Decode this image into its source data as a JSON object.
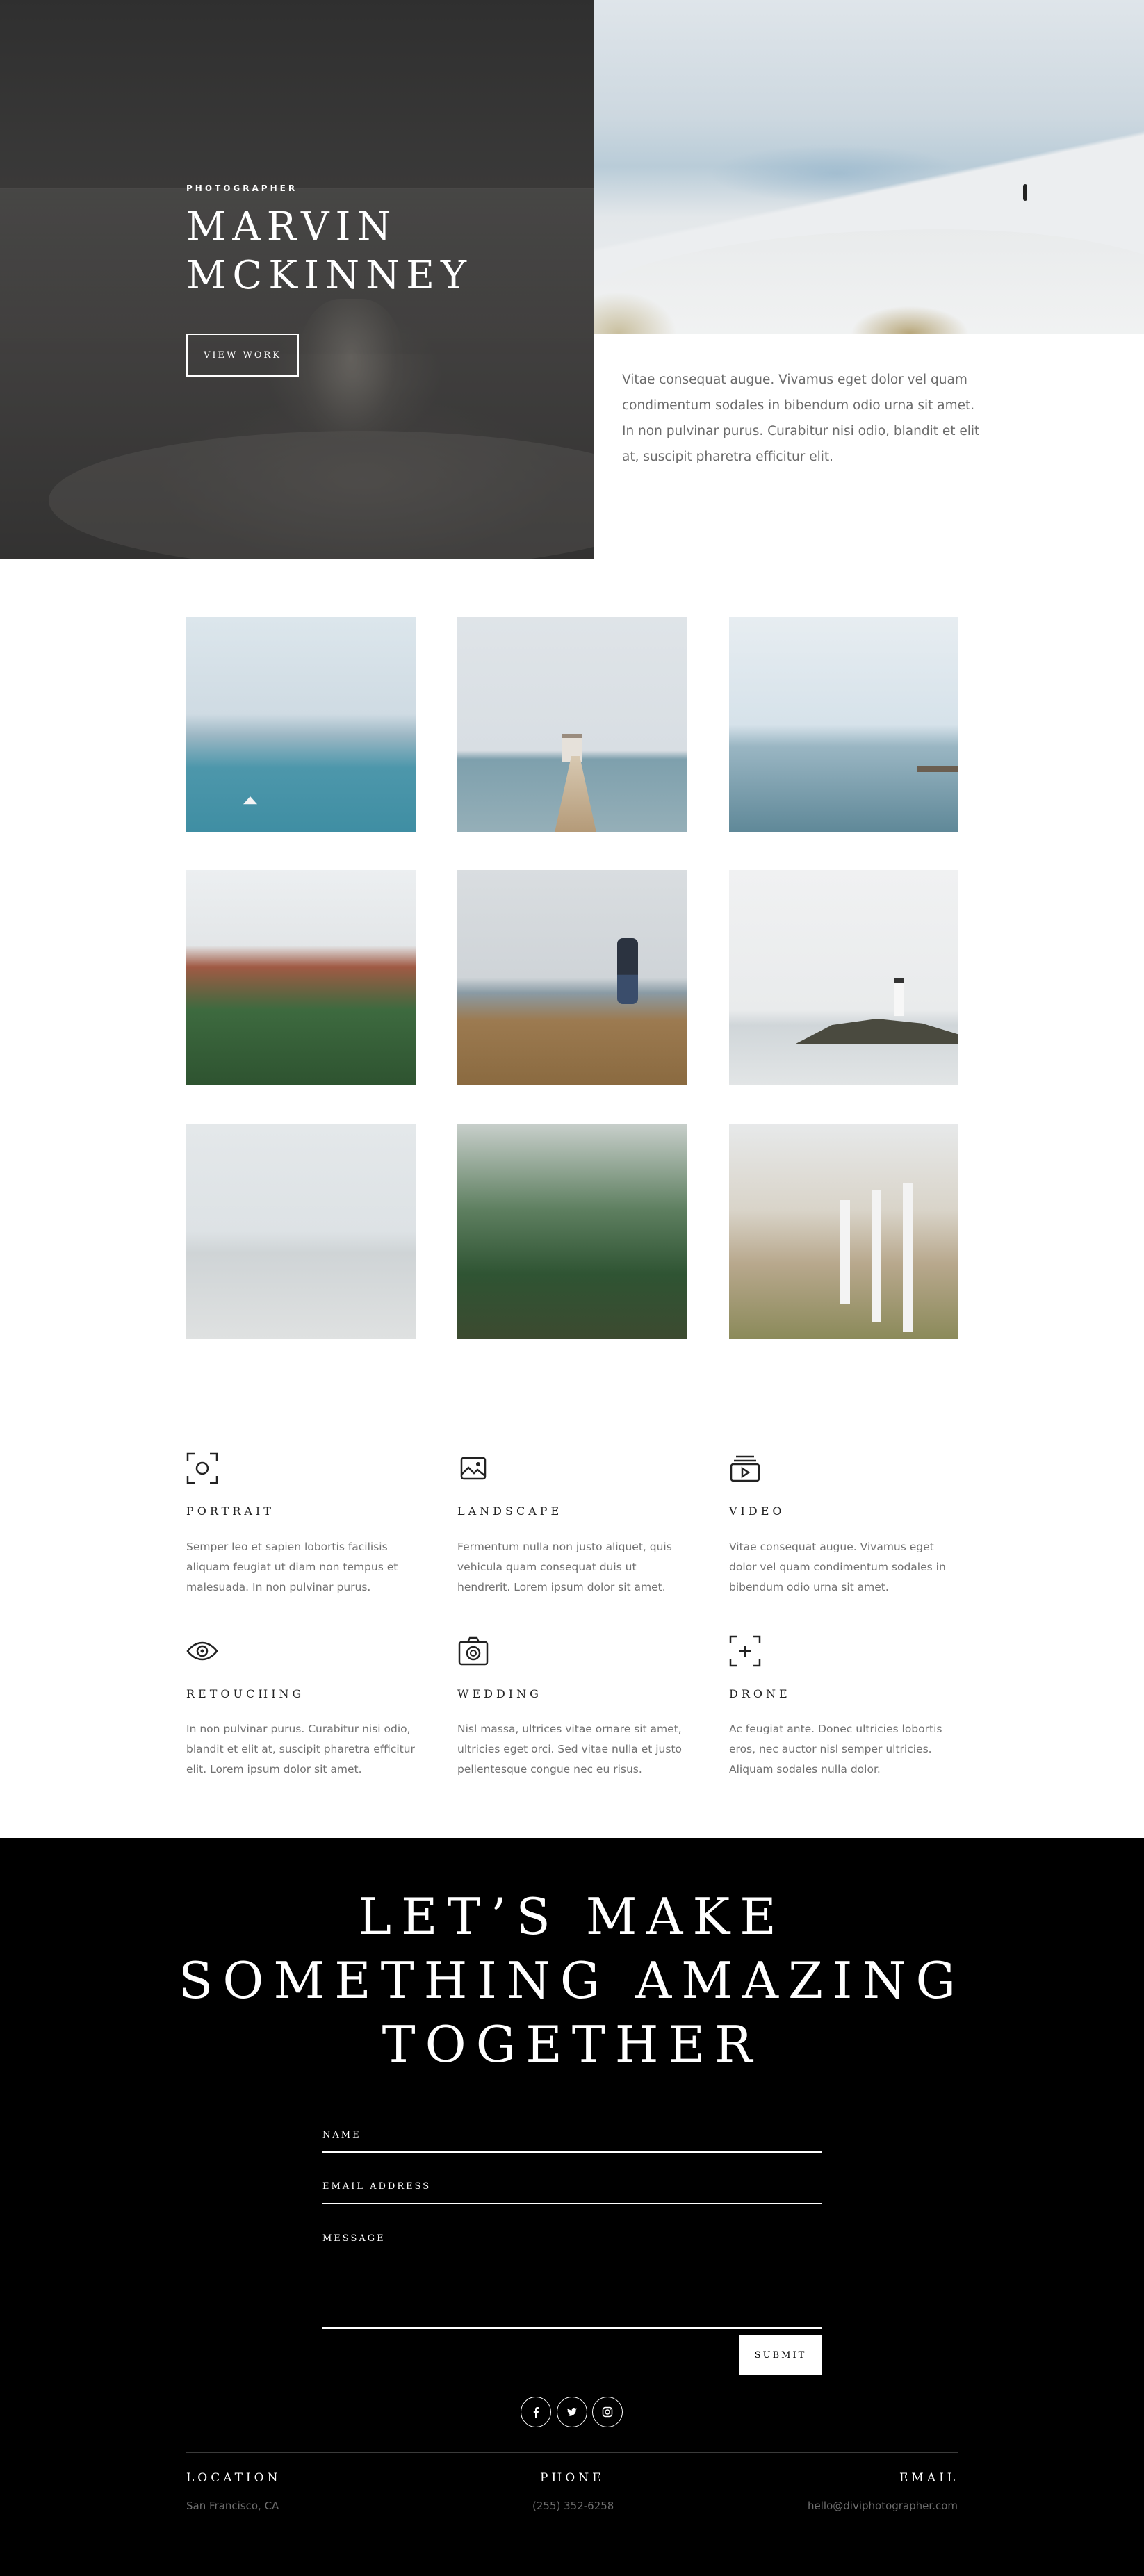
{
  "hero": {
    "eyebrow": "PHOTOGRAPHER",
    "name_line1": "MARVIN",
    "name_line2": "MCKINNEY",
    "button_label": "VIEW WORK",
    "intro_text": "Vitae consequat augue. Vivamus eget dolor vel quam condimentum sodales in bibendum odio urna sit amet. In non pulvinar purus. Curabitur nisi odio, blandit et elit at, suscipit pharetra efficitur elit."
  },
  "gallery": {
    "images": [
      {
        "subject": "sea with sailboat"
      },
      {
        "subject": "pier with pavilion"
      },
      {
        "subject": "calm sea with jetty"
      },
      {
        "subject": "red rock forest"
      },
      {
        "subject": "hiker on cliff"
      },
      {
        "subject": "lighthouse on rocks"
      },
      {
        "subject": "snowy field"
      },
      {
        "subject": "misty pine forest"
      },
      {
        "subject": "rope fence path"
      }
    ]
  },
  "services": [
    {
      "icon": "portrait-icon",
      "title": "PORTRAIT",
      "text": "Semper leo et sapien lobortis facilisis aliquam feugiat ut diam non tempus et malesuada. In non pulvinar purus."
    },
    {
      "icon": "landscape-icon",
      "title": "LANDSCAPE",
      "text": "Fermentum nulla non justo aliquet, quis vehicula quam consequat duis ut hendrerit. Lorem ipsum dolor sit amet."
    },
    {
      "icon": "video-icon",
      "title": "VIDEO",
      "text": "Vitae consequat augue. Vivamus eget dolor vel quam condimentum sodales in bibendum odio urna sit amet."
    },
    {
      "icon": "eye-icon",
      "title": "RETOUCHING",
      "text": "In non pulvinar purus. Curabitur nisi odio, blandit et elit at, suscipit pharetra efficitur elit. Lorem ipsum dolor sit amet."
    },
    {
      "icon": "camera-icon",
      "title": "WEDDING",
      "text": "Nisl massa, ultrices vitae ornare sit amet, ultricies eget orci. Sed vitae nulla et justo pellentesque congue nec eu risus."
    },
    {
      "icon": "crosshair-icon",
      "title": "DRONE",
      "text": "Ac feugiat ante. Donec ultricies lobortis eros, nec auctor nisl semper ultricies. Aliquam sodales nulla dolor."
    }
  ],
  "contact": {
    "heading_line1": "LET’S MAKE",
    "heading_line2": "SOMETHING AMAZING",
    "heading_line3": "TOGETHER",
    "name_label": "NAME",
    "email_label": "EMAIL ADDRESS",
    "message_label": "MESSAGE",
    "submit_label": "SUBMIT"
  },
  "social": [
    "facebook-icon",
    "twitter-icon",
    "instagram-icon"
  ],
  "footer": {
    "location_label": "LOCATION",
    "location_value": "San Francisco, CA",
    "phone_label": "PHONE",
    "phone_value": "(255) 352-6258",
    "email_label": "EMAIL",
    "email_value": "hello@diviphotographer.com"
  },
  "colors": {
    "background": "#ffffff",
    "footer_background": "#000000",
    "text_dark": "#222222",
    "text_body": "#717171",
    "hero_overlay": "#3a3a3a"
  }
}
